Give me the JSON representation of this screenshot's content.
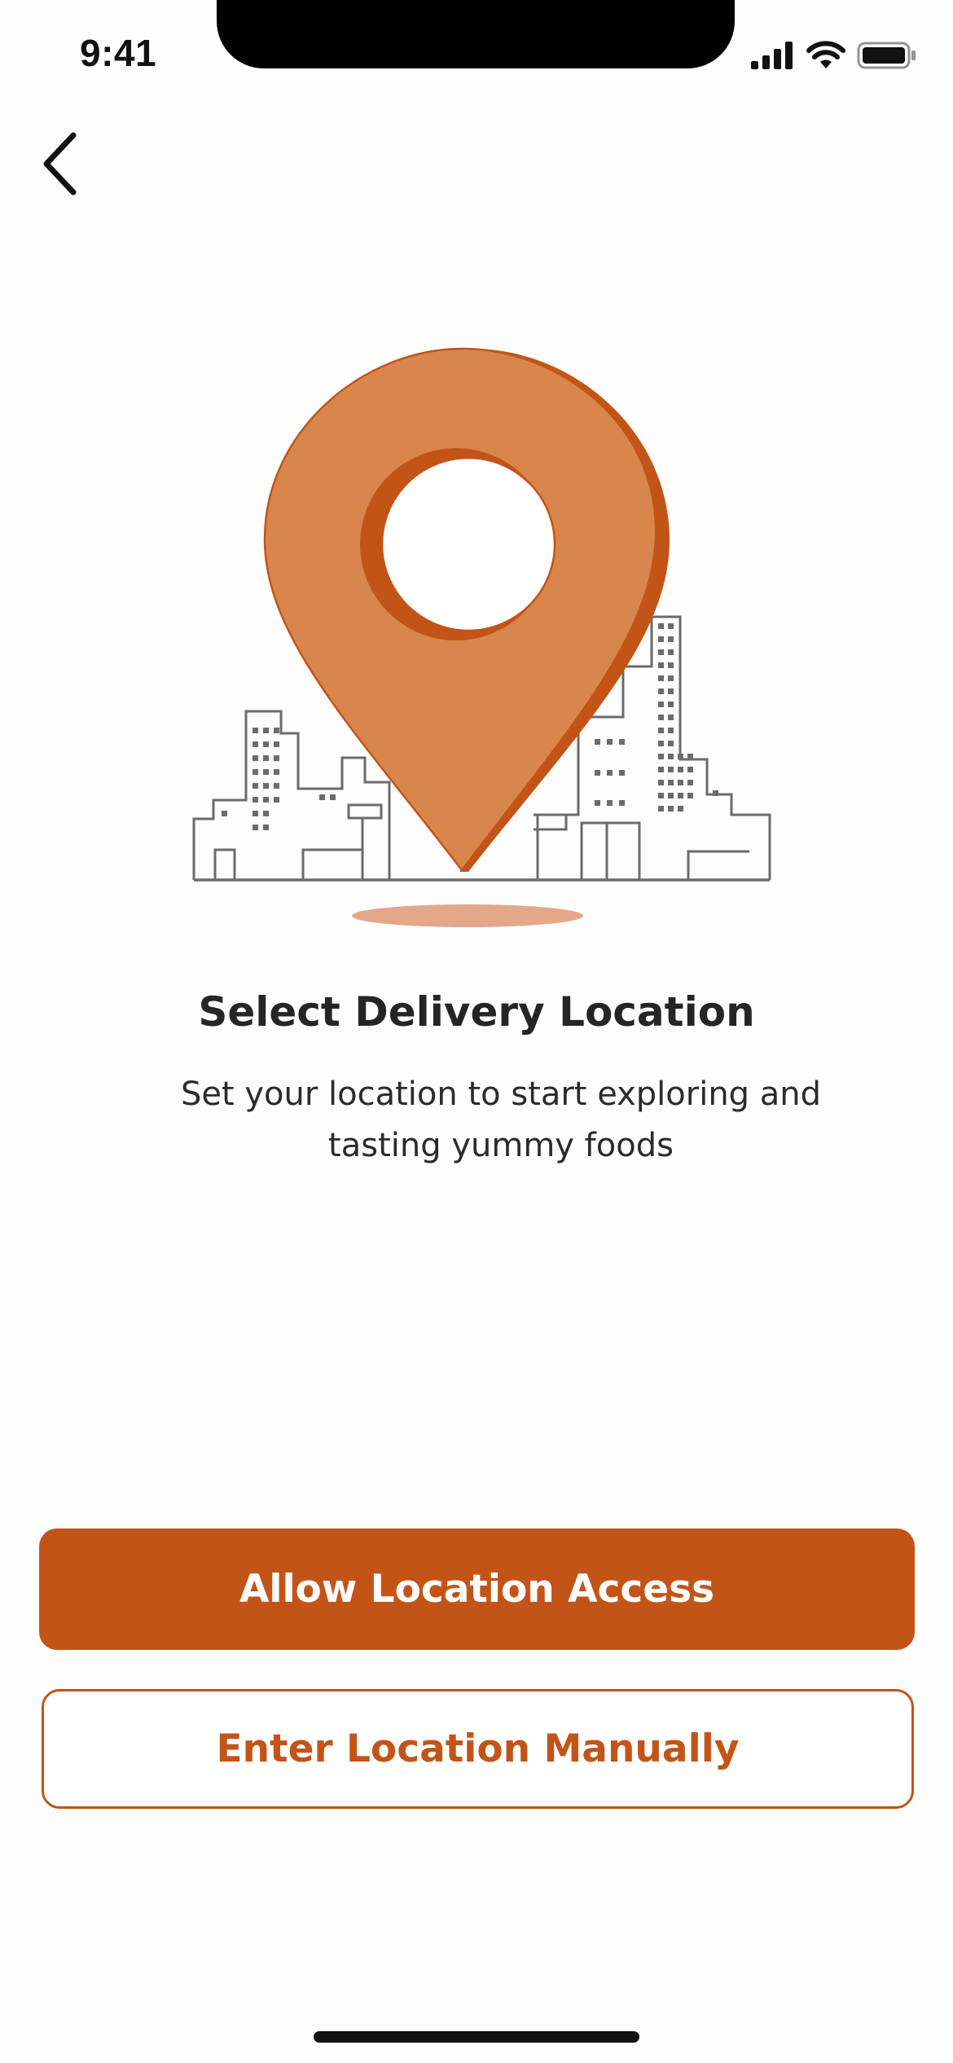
{
  "status_bar": {
    "time": "9:41"
  },
  "icons": {
    "back": "chevron-left-icon",
    "signal": "cellular-signal-icon",
    "wifi": "wifi-icon",
    "battery": "battery-icon",
    "illustration": "location-pin-city-illustration"
  },
  "colors": {
    "accent": "#c35418",
    "pin_fill": "#d8864c",
    "pin_shade": "#c35418",
    "shadow": "#e3a88a",
    "text": "#252525"
  },
  "main": {
    "title": "Select Delivery Location",
    "subtitle": "Set your location to start exploring and tasting yummy foods"
  },
  "actions": {
    "allow_label": "Allow Location Access",
    "manual_label": "Enter Location Manually"
  }
}
